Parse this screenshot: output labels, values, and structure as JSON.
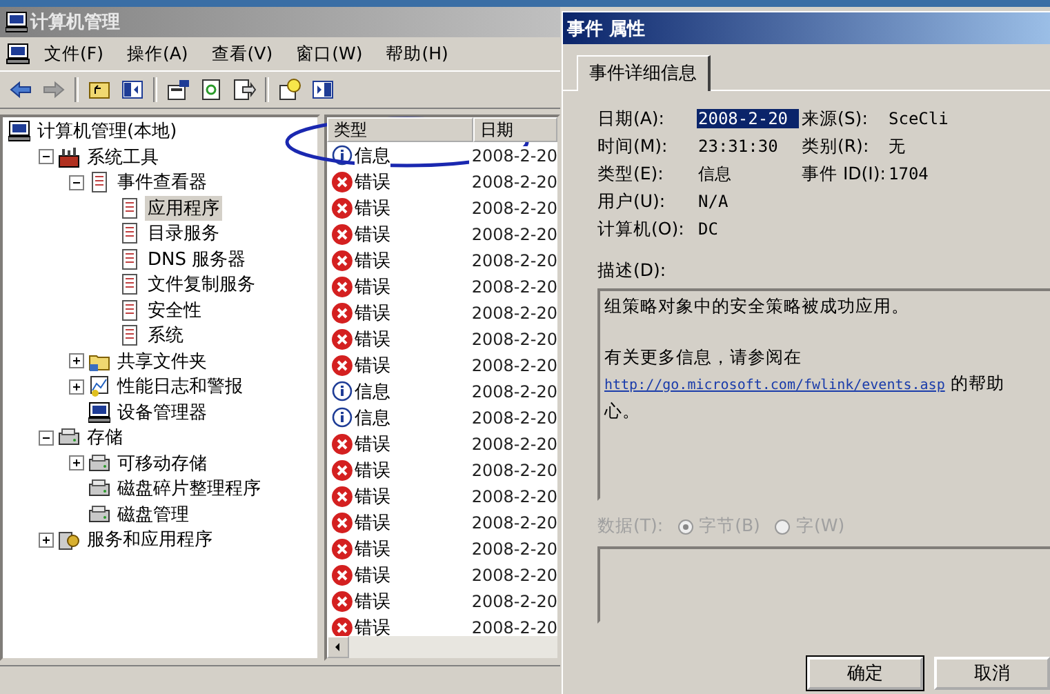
{
  "main_window": {
    "title": "计算机管理",
    "menu": [
      "文件(F)",
      "操作(A)",
      "查看(V)",
      "窗口(W)",
      "帮助(H)"
    ],
    "tree": [
      {
        "label": "计算机管理(本地)",
        "kind": "computer",
        "selected": false,
        "children": [
          {
            "label": "系统工具",
            "kind": "tools",
            "selected": false,
            "expanded": true,
            "children": [
              {
                "label": "事件查看器",
                "kind": "log",
                "selected": false,
                "expanded": true,
                "children": [
                  {
                    "label": "应用程序",
                    "kind": "log",
                    "selected": true
                  },
                  {
                    "label": "目录服务",
                    "kind": "log",
                    "selected": false
                  },
                  {
                    "label": "DNS 服务器",
                    "kind": "log",
                    "selected": false
                  },
                  {
                    "label": "文件复制服务",
                    "kind": "log",
                    "selected": false
                  },
                  {
                    "label": "安全性",
                    "kind": "log",
                    "selected": false
                  },
                  {
                    "label": "系统",
                    "kind": "log",
                    "selected": false
                  }
                ]
              },
              {
                "label": "共享文件夹",
                "kind": "folder",
                "selected": false,
                "expanded": false
              },
              {
                "label": "性能日志和警报",
                "kind": "chart",
                "selected": false,
                "expanded": false
              },
              {
                "label": "设备管理器",
                "kind": "computer",
                "selected": false
              }
            ]
          },
          {
            "label": "存储",
            "kind": "drive",
            "selected": false,
            "expanded": true,
            "children": [
              {
                "label": "可移动存储",
                "kind": "drive",
                "selected": false,
                "expanded": false
              },
              {
                "label": "磁盘碎片整理程序",
                "kind": "drive",
                "selected": false
              },
              {
                "label": "磁盘管理",
                "kind": "drive",
                "selected": false
              }
            ]
          },
          {
            "label": "服务和应用程序",
            "kind": "gear",
            "selected": false,
            "expanded": false
          }
        ]
      }
    ],
    "list": {
      "columns": [
        "类型",
        "日期"
      ],
      "rows": [
        {
          "kind": "info",
          "type": "信息",
          "date": "2008-2-20"
        },
        {
          "kind": "error",
          "type": "错误",
          "date": "2008-2-20"
        },
        {
          "kind": "error",
          "type": "错误",
          "date": "2008-2-20"
        },
        {
          "kind": "error",
          "type": "错误",
          "date": "2008-2-20"
        },
        {
          "kind": "error",
          "type": "错误",
          "date": "2008-2-20"
        },
        {
          "kind": "error",
          "type": "错误",
          "date": "2008-2-20"
        },
        {
          "kind": "error",
          "type": "错误",
          "date": "2008-2-20"
        },
        {
          "kind": "error",
          "type": "错误",
          "date": "2008-2-20"
        },
        {
          "kind": "error",
          "type": "错误",
          "date": "2008-2-20"
        },
        {
          "kind": "info",
          "type": "信息",
          "date": "2008-2-20"
        },
        {
          "kind": "info",
          "type": "信息",
          "date": "2008-2-20"
        },
        {
          "kind": "error",
          "type": "错误",
          "date": "2008-2-20"
        },
        {
          "kind": "error",
          "type": "错误",
          "date": "2008-2-20"
        },
        {
          "kind": "error",
          "type": "错误",
          "date": "2008-2-20"
        },
        {
          "kind": "error",
          "type": "错误",
          "date": "2008-2-20"
        },
        {
          "kind": "error",
          "type": "错误",
          "date": "2008-2-20"
        },
        {
          "kind": "error",
          "type": "错误",
          "date": "2008-2-20"
        },
        {
          "kind": "error",
          "type": "错误",
          "date": "2008-2-20"
        },
        {
          "kind": "error",
          "type": "错误",
          "date": "2008-2-20"
        }
      ]
    }
  },
  "dialog": {
    "title": "事件 属性",
    "tabs": [
      {
        "label": "事件详细信息",
        "selected": true
      }
    ],
    "fields": [
      {
        "cells": [
          {
            "label": "日期(A):",
            "value": "2008-2-20",
            "highlighted": true
          },
          {
            "label": "来源(S):",
            "value": "SceCli",
            "highlighted": false
          }
        ]
      },
      {
        "cells": [
          {
            "label": "时间(M):",
            "value": "23:31:30",
            "highlighted": false
          },
          {
            "label": "类别(R):",
            "value": "无",
            "highlighted": false
          }
        ]
      },
      {
        "cells": [
          {
            "label": "类型(E):",
            "value": "信息",
            "highlighted": false
          },
          {
            "label": "事件 ID(I):",
            "value": "1704",
            "highlighted": false
          }
        ]
      },
      {
        "cells": [
          {
            "label": "用户(U):",
            "value": "N/A",
            "highlighted": false
          }
        ]
      },
      {
        "cells": [
          {
            "label": "计算机(O):",
            "value": "DC",
            "highlighted": false
          }
        ]
      }
    ],
    "description": {
      "label": "描述(D):",
      "line1": "组策略对象中的安全策略被成功应用。",
      "line2": "有关更多信息，请参阅在",
      "link": "http://go.microsoft.com/fwlink/events.asp",
      "after_link": " 的帮助",
      "line4": "心。"
    },
    "data": {
      "label": "数据(T):",
      "disabled": true,
      "options": [
        {
          "label": "字节(B)",
          "selected": true
        },
        {
          "label": "字(W)",
          "selected": false
        }
      ]
    },
    "buttons": [
      "确定",
      "取消"
    ]
  }
}
